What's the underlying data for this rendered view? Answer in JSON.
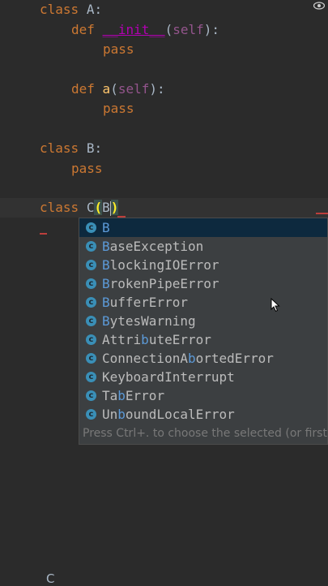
{
  "code": {
    "line1": {
      "kw": "class",
      "name": "A:"
    },
    "line2": {
      "kw": "def",
      "dunder": "__init__",
      "open": "(",
      "self": "self",
      "close": "):"
    },
    "line3": {
      "kw": "pass"
    },
    "line4": {
      "kw": "def",
      "fn": "a",
      "open": "(",
      "self": "self",
      "close": "):"
    },
    "line5": {
      "kw": "pass"
    },
    "line6": {
      "kw": "class",
      "name": "B:"
    },
    "line7": {
      "kw": "pass"
    },
    "line8": {
      "kw": "class",
      "name": "C",
      "open": "(",
      "typed": "B",
      "close": ")"
    }
  },
  "autocomplete": {
    "items": [
      {
        "icon": "c",
        "pre": "",
        "match": "B",
        "post": ""
      },
      {
        "icon": "c",
        "pre": "",
        "match": "B",
        "post": "aseException"
      },
      {
        "icon": "c",
        "pre": "",
        "match": "B",
        "post": "lockingIOError"
      },
      {
        "icon": "c",
        "pre": "",
        "match": "B",
        "post": "rokenPipeError"
      },
      {
        "icon": "c",
        "pre": "",
        "match": "B",
        "post": "ufferError"
      },
      {
        "icon": "c",
        "pre": "",
        "match": "B",
        "post": "ytesWarning"
      },
      {
        "icon": "c",
        "pre": "Attri",
        "match": "b",
        "post": "uteError"
      },
      {
        "icon": "c",
        "pre": "ConnectionA",
        "match": "b",
        "post": "ortedError"
      },
      {
        "icon": "c",
        "pre": "Keyboard",
        "match": "",
        "post": "Interrupt"
      },
      {
        "icon": "c",
        "pre": "Ta",
        "match": "b",
        "post": "Error"
      },
      {
        "icon": "c",
        "pre": "Un",
        "match": "b",
        "post": "oundLocalError"
      }
    ],
    "hint": "Press Ctrl+. to choose the selected (or first)"
  },
  "status": {
    "letter": "C"
  },
  "colors": {
    "background": "#2b2b2b",
    "keyword": "#cc7832",
    "popup": "#3c3f41",
    "match": "#5c9ad8"
  }
}
